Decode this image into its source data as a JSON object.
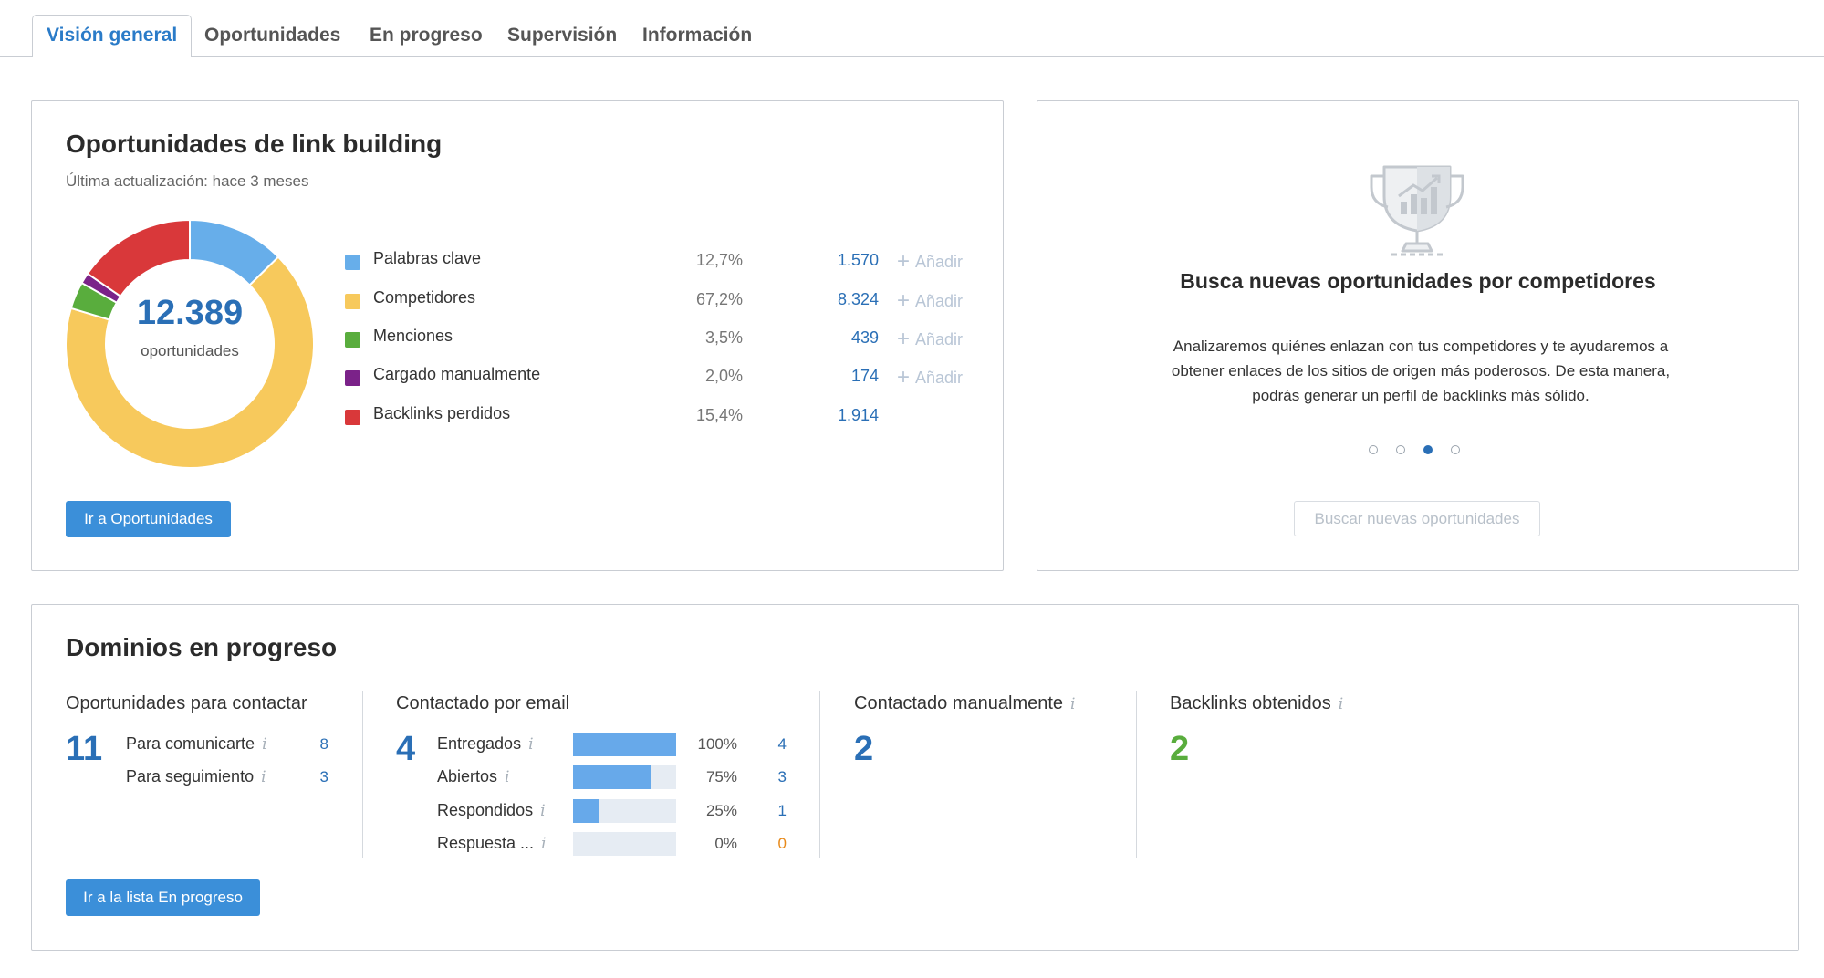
{
  "tabs": [
    {
      "label": "Visión general",
      "active": true
    },
    {
      "label": "Oportunidades"
    },
    {
      "label": "En progreso"
    },
    {
      "label": "Supervisión"
    },
    {
      "label": "Información"
    }
  ],
  "opportunities": {
    "title": "Oportunidades de link building",
    "updated": "Última actualización: hace 3 meses",
    "total": "12.389",
    "total_label": "oportunidades",
    "legend": [
      {
        "label": "Palabras clave",
        "pct": "12,7%",
        "count": "1.570",
        "add": "Añadir",
        "color": "#67aeea"
      },
      {
        "label": "Competidores",
        "pct": "67,2%",
        "count": "8.324",
        "add": "Añadir",
        "color": "#f7c95c"
      },
      {
        "label": "Menciones",
        "pct": "3,5%",
        "count": "439",
        "add": "Añadir",
        "color": "#59ad3d"
      },
      {
        "label": "Cargado manualmente",
        "pct": "2,0%",
        "count": "174",
        "add": "Añadir",
        "color": "#7b2289"
      },
      {
        "label": "Backlinks perdidos",
        "pct": "15,4%",
        "count": "1.914",
        "add": "",
        "color": "#d9383a"
      }
    ],
    "button": "Ir a Oportunidades"
  },
  "chart_data": {
    "type": "pie",
    "categories": [
      "Palabras clave",
      "Competidores",
      "Menciones",
      "Cargado manualmente",
      "Backlinks perdidos"
    ],
    "values": [
      1570,
      8324,
      439,
      174,
      1914
    ],
    "percentages": [
      12.7,
      67.2,
      3.5,
      2.0,
      15.4
    ],
    "colors": [
      "#67aeea",
      "#f7c95c",
      "#59ad3d",
      "#7b2289",
      "#d9383a"
    ],
    "title": "",
    "donut": true,
    "center_label": "12.389 oportunidades"
  },
  "competitors_card": {
    "title": "Busca nuevas oportunidades por competidores",
    "description": "Analizaremos quiénes enlazan con tus competidores y te ayudaremos a obtener enlaces de los sitios de origen más poderosos. De esta manera, podrás generar un perfil de backlinks más sólido.",
    "carousel_active_index": 2,
    "carousel_count": 4,
    "icon": "trophy-chart-icon",
    "button": "Buscar nuevas oportunidades"
  },
  "in_progress": {
    "title": "Dominios en progreso",
    "to_contact": {
      "header": "Oportunidades para contactar",
      "total": "11",
      "rows": [
        {
          "label": "Para comunicarte",
          "value": "8"
        },
        {
          "label": "Para seguimiento",
          "value": "3"
        }
      ]
    },
    "email": {
      "header": "Contactado por email",
      "total": "4",
      "rows": [
        {
          "label": "Entregados",
          "pct": "100%",
          "count": "4",
          "fraction": 1.0
        },
        {
          "label": "Abiertos",
          "pct": "75%",
          "count": "3",
          "fraction": 0.75
        },
        {
          "label": "Respondidos",
          "pct": "25%",
          "count": "1",
          "fraction": 0.25
        },
        {
          "label": "Respuesta ...",
          "pct": "0%",
          "count": "0",
          "fraction": 0.0
        }
      ]
    },
    "manual": {
      "header": "Contactado manualmente",
      "total": "2"
    },
    "obtained": {
      "header": "Backlinks obtenidos",
      "total": "2"
    },
    "button": "Ir a la lista En progreso",
    "info_glyph": "i",
    "colors": {
      "total_blue": "#2a6fb6",
      "obtained_green": "#59ad3d",
      "zero_orange": "#e88a1a"
    }
  }
}
